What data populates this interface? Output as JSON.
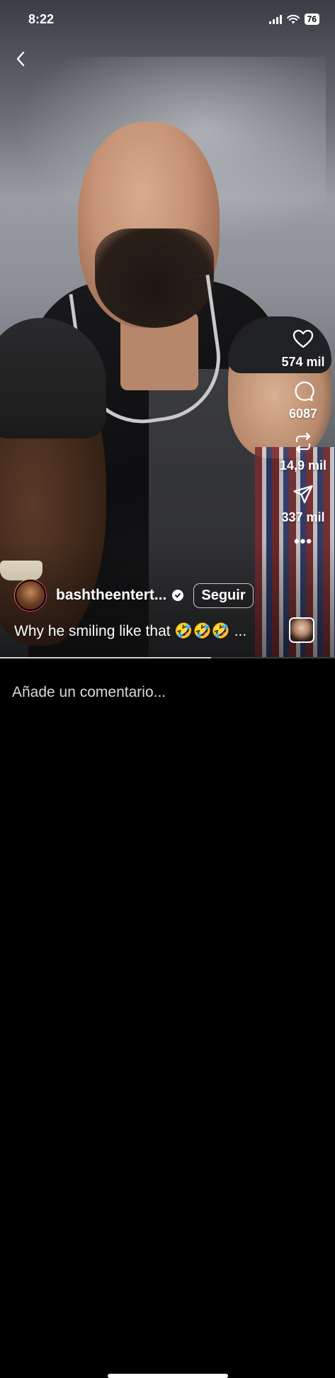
{
  "status_bar": {
    "time": "8:22",
    "battery": "76"
  },
  "reel": {
    "author": {
      "username": "bashtheentert...",
      "verified": true,
      "follow_label": "Seguir"
    },
    "caption": "Why he smiling like that 🤣🤣🤣 ...",
    "actions": {
      "likes": "574 mil",
      "comments": "6087",
      "reposts": "14,9 mil",
      "shares": "337 mil"
    },
    "progress": 0.63
  },
  "comment_bar": {
    "placeholder": "Añade un comentario..."
  },
  "icons": [
    "back-icon",
    "heart-icon",
    "comment-icon",
    "repost-icon",
    "share-icon",
    "more-icon",
    "verified-icon"
  ],
  "colors": {
    "background": "#000000",
    "text": "#ffffff",
    "story_ring_start": "#f7c13a",
    "story_ring_end": "#b530b8"
  }
}
